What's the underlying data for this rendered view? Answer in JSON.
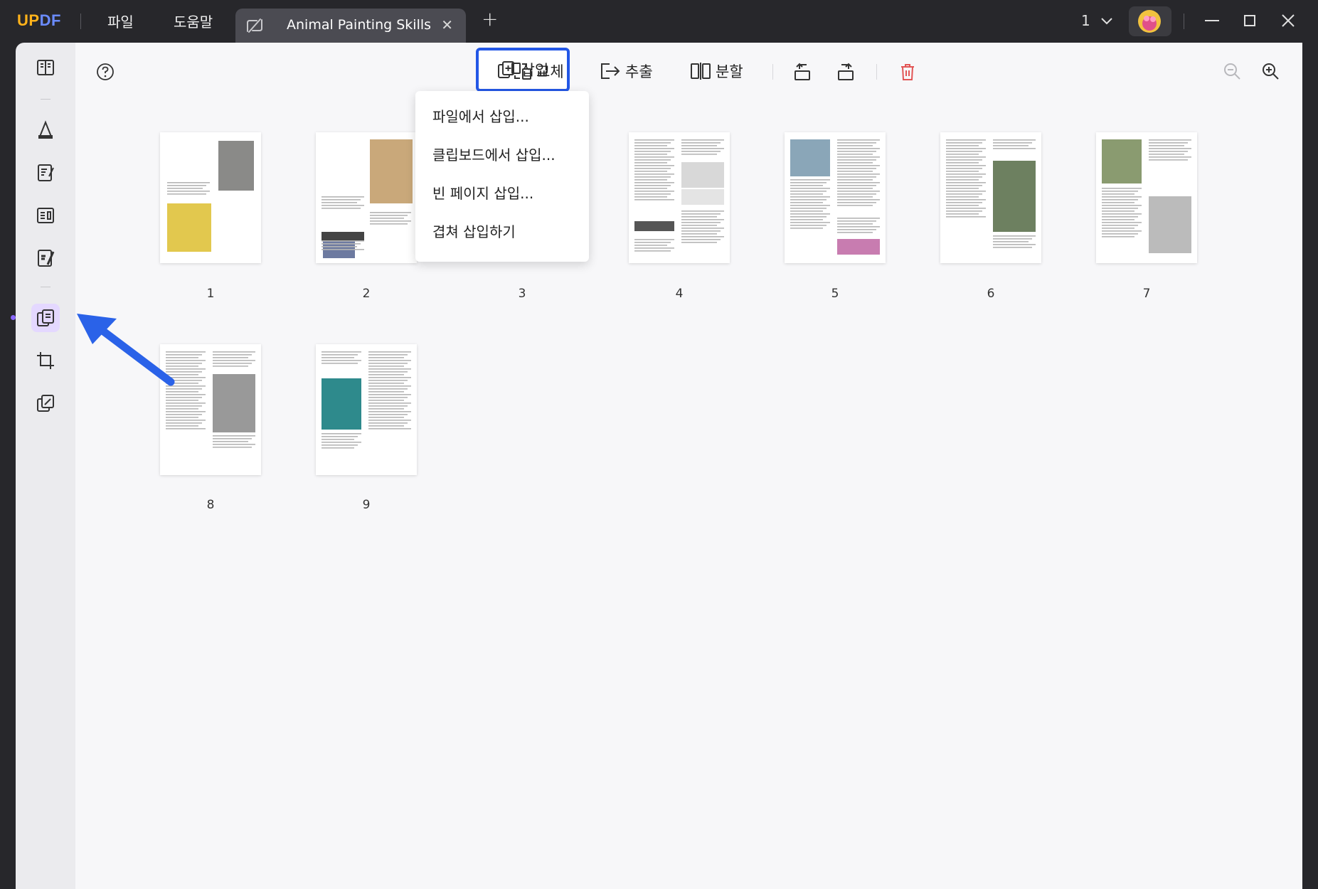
{
  "titlebar": {
    "logo_part1": "UP",
    "logo_part2": "DF",
    "menu": [
      "파일",
      "도움말"
    ],
    "tab_title": "Animal Painting Skills",
    "tab_close": "✕",
    "new_tab": "+",
    "page_selector": "1"
  },
  "toolbar": {
    "insert_label": "삽입",
    "replace_label": "교체",
    "extract_label": "추출",
    "split_label": "분할"
  },
  "insert_menu": {
    "items": [
      "파일에서 삽입...",
      "클립보드에서 삽입...",
      "빈 페이지 삽입...",
      "겹쳐 삽입하기"
    ]
  },
  "pages": {
    "labels": [
      "1",
      "2",
      "3",
      "4",
      "5",
      "6",
      "7",
      "8",
      "9"
    ]
  },
  "colors": {
    "accent": "#2357e6",
    "active_tool": "#8a68ff",
    "delete": "#e25555",
    "annotation_arrow": "#2a62e8"
  }
}
